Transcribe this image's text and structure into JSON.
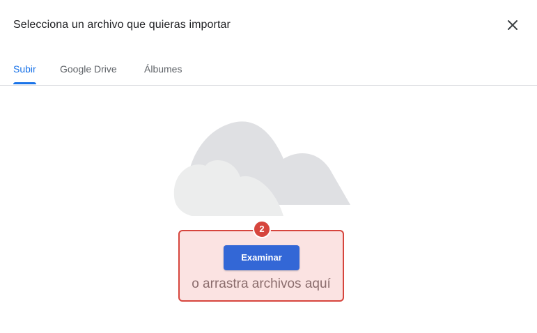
{
  "dialog": {
    "title": "Selecciona un archivo que quieras importar",
    "close_icon": "close-icon"
  },
  "tabs": [
    {
      "label": "Subir",
      "active": true
    },
    {
      "label": "Google Drive",
      "active": false
    },
    {
      "label": "Álbumes",
      "active": false
    }
  ],
  "upload": {
    "illustration_icon": "cloud-icon",
    "step_badge": "2",
    "browse_label": "Examinar",
    "drag_text": "o arrastra archivos aquí"
  },
  "colors": {
    "accent": "#1a73e8",
    "button": "#3367d6",
    "highlight_border": "#d6453d",
    "highlight_fill": "#fbe3e2",
    "cloud": "#dfe0e3"
  }
}
